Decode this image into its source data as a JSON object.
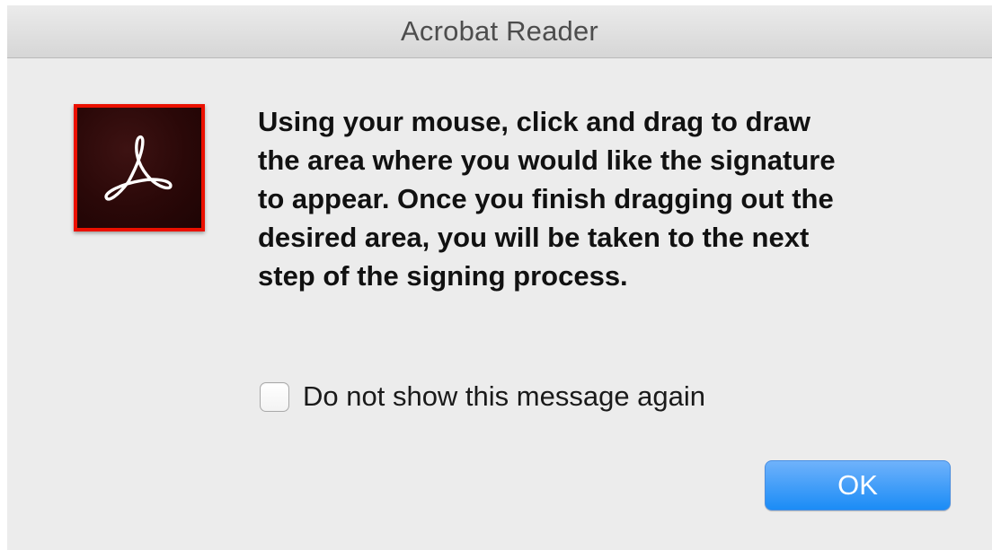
{
  "window": {
    "title": "Acrobat Reader"
  },
  "icon": {
    "name": "adobe-acrobat-icon",
    "border_color": "#eb1000",
    "background_color": "#2a0808"
  },
  "message": "Using your mouse, click and drag to draw\nthe area where you would like the signature\nto appear. Once you finish dragging out the\ndesired area, you will be taken to the next\nstep of the signing process.",
  "checkbox": {
    "label": "Do not show this message again",
    "checked": false
  },
  "buttons": {
    "ok_label": "OK",
    "ok_color": "#1b8cf6"
  }
}
